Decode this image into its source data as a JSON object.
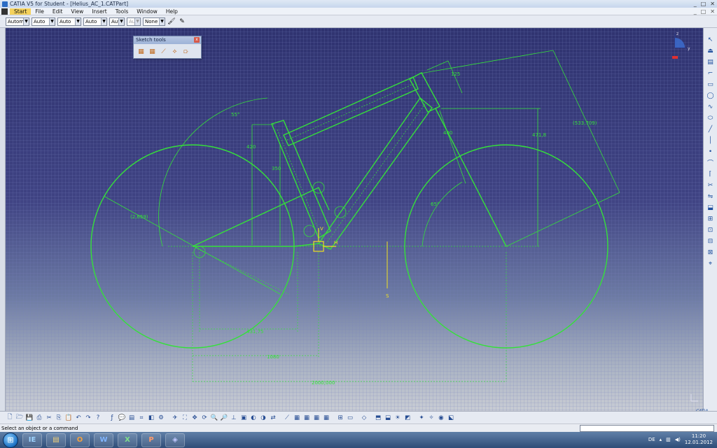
{
  "window": {
    "title": "CATIA V5 for Student - [Helius_AC_1.CATPart]",
    "controls": [
      "_",
      "□",
      "✕"
    ]
  },
  "menu": {
    "items": [
      "Start",
      "File",
      "Edit",
      "View",
      "Insert",
      "Tools",
      "Window",
      "Help"
    ]
  },
  "toolbar": {
    "selects": [
      "Autom",
      "Auto",
      "Auto",
      "Auto",
      "Aut",
      "Aut",
      "None"
    ]
  },
  "palette": {
    "title": "Sketch tools",
    "close": "x"
  },
  "compass": {
    "z": "z",
    "y": "y"
  },
  "sketch": {
    "dimensions": {
      "d125": "125",
      "d533": "(533,709)",
      "d55": "55°",
      "d420": "420",
      "d350": "350",
      "d400": "400",
      "d471": "471,8",
      "d65": "65°",
      "d2659": "(2,659)",
      "dH": "H",
      "dV": "V",
      "dS": "S",
      "dBottom1": "431,75",
      "dBottom2": "1080",
      "dBottom3": "2000,000"
    },
    "colors": {
      "geometry": "#35e03a",
      "axis": "#f0e020"
    }
  },
  "statusbar": {
    "message": "Select an object or a command"
  },
  "taskbar": {
    "apps": [
      "IE",
      "▤",
      "O",
      "W",
      "X",
      "P",
      "◈"
    ],
    "language": "DE",
    "time": "11:20",
    "date": "12.01.2012"
  },
  "brand": {
    "logo_text": "CATIA"
  }
}
